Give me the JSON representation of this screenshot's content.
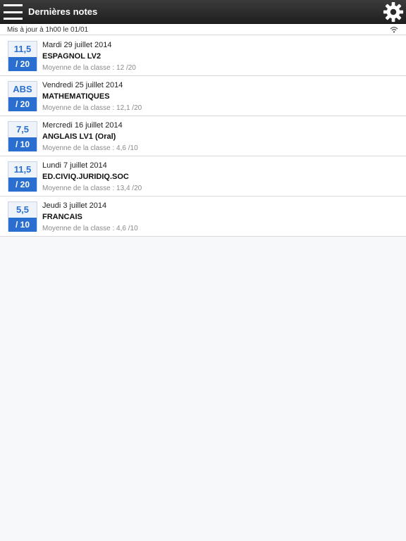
{
  "header": {
    "title": "Dernières notes",
    "menu_icon": "hamburger-menu-icon",
    "settings_icon": "gear-icon"
  },
  "status": {
    "update_text": "Mis à jour à 1h00 le 01/01",
    "connection_icon": "wifi-icon"
  },
  "colors": {
    "accent": "#2a6fcf",
    "header_bg": "#2b2b2b"
  },
  "grades": [
    {
      "value": "11,5",
      "scale": "/ 20",
      "date": "Mardi 29 juillet 2014",
      "subject": "ESPAGNOL LV2",
      "average": "Moyenne de la classe : 12 /20"
    },
    {
      "value": "ABS",
      "scale": "/ 20",
      "date": "Vendredi 25 juillet 2014",
      "subject": "MATHEMATIQUES",
      "average": "Moyenne de la classe : 12,1 /20"
    },
    {
      "value": "7,5",
      "scale": "/ 10",
      "date": "Mercredi 16 juillet 2014",
      "subject": "ANGLAIS LV1 (Oral)",
      "average": "Moyenne de la classe : 4,6 /10"
    },
    {
      "value": "11,5",
      "scale": "/ 20",
      "date": "Lundi 7 juillet 2014",
      "subject": "ED.CIVIQ.JURIDIQ.SOC",
      "average": "Moyenne de la classe : 13,4 /20"
    },
    {
      "value": "5,5",
      "scale": "/ 10",
      "date": "Jeudi 3 juillet 2014",
      "subject": "FRANCAIS",
      "average": "Moyenne de la classe : 4,6 /10"
    }
  ]
}
